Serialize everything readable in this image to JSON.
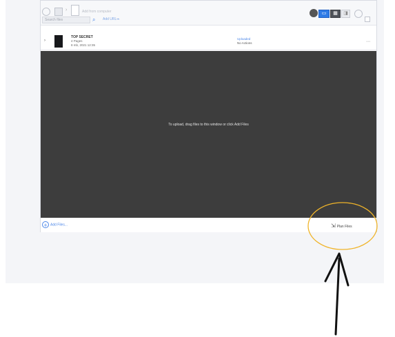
{
  "toolbar": {
    "title_text": "Add from computer",
    "search_placeholder": "Search files",
    "link_text": "Add URL",
    "view_modes": [
      "list",
      "grid",
      "preview"
    ]
  },
  "file": {
    "name": "TOP SECRET",
    "pages": "4 Pages",
    "size": "8 mb, 2021 12:35",
    "status_top": "Uploaded",
    "status_bottom": "No Actions"
  },
  "drop_text": "To upload, drag files to this window or click Add Files",
  "bottom": {
    "add_files_label": "Add Files...",
    "plan_label": "Plan Files"
  },
  "colors": {
    "accent": "#2f7be6",
    "dropzone": "#3d3d3d",
    "annotation": "#f0b429",
    "arrow": "#111111"
  }
}
